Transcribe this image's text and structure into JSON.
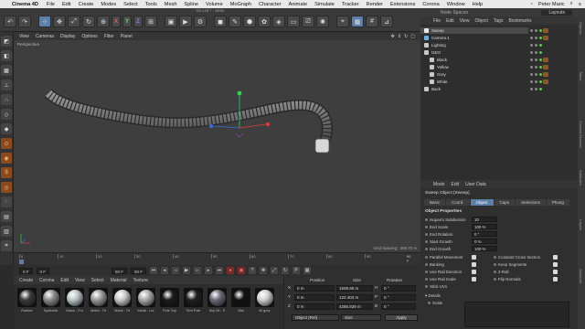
{
  "menubar": {
    "app": "Cinema 4D",
    "items": [
      "File",
      "Edit",
      "Create",
      "Modes",
      "Select",
      "Tools",
      "Mesh",
      "Spline",
      "Volume",
      "MoGraph",
      "Character",
      "Animate",
      "Simulate",
      "Tracker",
      "Render",
      "Extensions",
      "Corona",
      "Window",
      "Help"
    ],
    "user": "Peter Maric"
  },
  "window": {
    "title": "03.c4d * - Main"
  },
  "toolbar": {
    "x": "X",
    "y": "Y",
    "z": "Z"
  },
  "viewport": {
    "menu": [
      "View",
      "Cameras",
      "Display",
      "Options",
      "Filter",
      "Panel"
    ],
    "label": "Perspective",
    "grid_spacing": "Grid Spacing : 350.70 m"
  },
  "timeline": {
    "ticks": [
      "0",
      "10",
      "20",
      "30",
      "40",
      "50",
      "60",
      "70",
      "80",
      "90"
    ],
    "end": "90 F",
    "start_field": "0 F",
    "current_field": "0 F",
    "max_field": "90 F",
    "end_field": "90 F"
  },
  "materials": {
    "menu": [
      "Create",
      "Corona",
      "Edit",
      "View",
      "Select",
      "Material",
      "Texture"
    ],
    "items": [
      {
        "name": "Rubber",
        "color": "#3a3a3a"
      },
      {
        "name": "Synthetic",
        "color": "#8a8a8a"
      },
      {
        "name": "Glass - Fro",
        "color": "#b9c4c8"
      },
      {
        "name": "Metal - Tit",
        "color": "#9a9a9a"
      },
      {
        "name": "Metal - Tit",
        "color": "#c8c8c8"
      },
      {
        "name": "Metal - Lut",
        "color": "#a9a9a9"
      },
      {
        "name": "Pole Top",
        "color": "#1a1a1a"
      },
      {
        "name": "Tent Pole",
        "color": "#1f1f1f"
      },
      {
        "name": "Sky 08 - S",
        "color": "#6a6a7a"
      },
      {
        "name": "Mat",
        "color": "#101010"
      },
      {
        "name": "lilt grey",
        "color": "#d0d0d0"
      }
    ]
  },
  "coords": {
    "headers": [
      "Position",
      "Size",
      "Rotation"
    ],
    "rows": [
      {
        "axis": "X",
        "pos": "0 m",
        "size": "1508.85 m",
        "rot_axis": "H",
        "rot": "0 °"
      },
      {
        "axis": "Y",
        "pos": "0 m",
        "size": "122.403 m",
        "rot_axis": "P",
        "rot": "0 °"
      },
      {
        "axis": "Z",
        "pos": "0 m",
        "size": "4285.839 m",
        "rot_axis": "B",
        "rot": "0 °"
      }
    ],
    "mode": "Object (Rel)",
    "size_mode": "Size",
    "apply": "Apply"
  },
  "right_head": {
    "node_spaces": "Node Spaces",
    "layouts": "Layouts"
  },
  "object_manager": {
    "menu": [
      "File",
      "Edit",
      "View",
      "Object",
      "Tags",
      "Bookmarks"
    ],
    "objects": [
      {
        "name": "Sweep",
        "indent": 0,
        "color": "#e8e8e8",
        "selected": true
      },
      {
        "name": "Camera.1",
        "indent": 0,
        "color": "#6ab0e8",
        "selected": false
      },
      {
        "name": "Lighting",
        "indent": 0,
        "color": "#c8c8c8",
        "selected": false
      },
      {
        "name": "GEO",
        "indent": 0,
        "color": "#c8c8c8",
        "selected": false
      },
      {
        "name": "Black",
        "indent": 1,
        "color": "#c8c8c8",
        "selected": false
      },
      {
        "name": "Yellow",
        "indent": 1,
        "color": "#c8c8c8",
        "selected": false
      },
      {
        "name": "Grey",
        "indent": 1,
        "color": "#c8c8c8",
        "selected": false
      },
      {
        "name": "White",
        "indent": 1,
        "color": "#c8c8c8",
        "selected": false
      },
      {
        "name": "Back",
        "indent": 0,
        "color": "#c8c8c8",
        "selected": false
      }
    ]
  },
  "vertical_tabs": [
    "Objects",
    "Takes",
    "Content Browser",
    "Attributes",
    "Layers",
    "Structure"
  ],
  "attributes": {
    "menu": [
      "Mode",
      "Edit",
      "User Data"
    ],
    "title": "Sweep Object [Sweep]",
    "tabs": [
      "Basic",
      "Coord.",
      "Object",
      "Caps",
      "Selections",
      "Phong"
    ],
    "active_tab": "Object",
    "section": "Object Properties",
    "fields": [
      {
        "label": "Isoparm Subdivision",
        "value": "10"
      },
      {
        "label": "End Scale",
        "value": "100 %"
      },
      {
        "label": "End Rotation",
        "value": "0 °"
      },
      {
        "label": "Start Growth",
        "value": "0 %"
      },
      {
        "label": "End Growth",
        "value": "100 %"
      }
    ],
    "checks_left": [
      "Parallel Movement",
      "Banking",
      "Use Rail Direction",
      "Use Rail Scale",
      "Stick UVs"
    ],
    "checks_right": [
      "Constant Cross Section",
      "Keep Segments",
      "2-Rail",
      "Flip Normals"
    ],
    "details": "Details",
    "scale": "Scale"
  }
}
